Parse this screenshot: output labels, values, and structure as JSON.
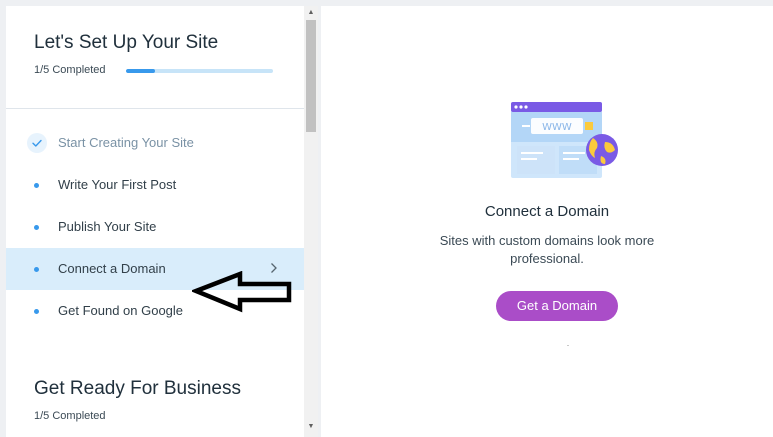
{
  "setup_section": {
    "title": "Let's Set Up Your Site",
    "progress_text": "1/5 Completed",
    "progress_fraction": 0.2,
    "steps": [
      {
        "label": "Start Creating Your Site",
        "done": true
      },
      {
        "label": "Write Your First Post",
        "done": false
      },
      {
        "label": "Publish Your Site",
        "done": false
      },
      {
        "label": "Connect a Domain",
        "done": false,
        "active": true
      },
      {
        "label": "Get Found on Google",
        "done": false
      }
    ]
  },
  "business_section": {
    "title": "Get Ready For Business",
    "progress_text": "1/5 Completed"
  },
  "detail": {
    "title": "Connect a Domain",
    "description": "Sites with custom domains look more professional.",
    "button_label": "Get a Domain",
    "illustration_text": "WWW",
    "icon": "globe-browser-illustration"
  },
  "colors": {
    "accent_blue": "#3899ec",
    "active_row": "#d9edfb",
    "button_purple": "#aa4dc8",
    "illustration_purple": "#7a5ae5",
    "illustration_yellow": "#fbca3c"
  }
}
